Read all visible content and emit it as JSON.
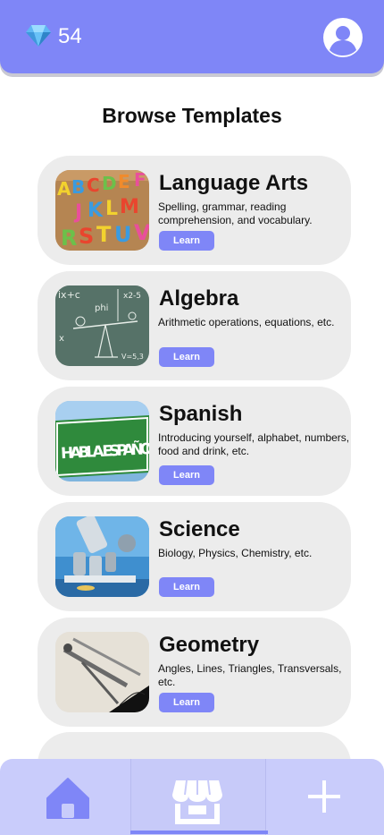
{
  "header": {
    "gem_icon": "diamond-icon",
    "gem_count": "54",
    "profile_icon": "user-avatar-icon"
  },
  "page_title": "Browse Templates",
  "templates": [
    {
      "title": "Language Arts",
      "description": "Spelling, grammar, reading comprehension, and vocabulary.",
      "learn_label": "Learn",
      "image": "alphabet-letters-image"
    },
    {
      "title": "Algebra",
      "description": "Arithmetic operations, equations, etc.",
      "learn_label": "Learn",
      "image": "chalkboard-equations-image"
    },
    {
      "title": "Spanish",
      "description": "Introducing yourself, alphabet, numbers, food and drink, etc.",
      "learn_label": "Learn",
      "image": "habla-espanol-sign-image",
      "image_text": "HABLA ESPAÑOL"
    },
    {
      "title": "Science",
      "description": "Biology, Physics, Chemistry, etc.",
      "learn_label": "Learn",
      "image": "microscope-image"
    },
    {
      "title": "Geometry",
      "description": "Angles, Lines, Triangles, Transversals, etc.",
      "learn_label": "Learn",
      "image": "compass-drawing-image"
    }
  ],
  "bottom_nav": {
    "items": [
      {
        "name": "home",
        "icon": "home-icon"
      },
      {
        "name": "store",
        "icon": "storefront-icon",
        "active": true
      },
      {
        "name": "create",
        "icon": "plus-icon"
      }
    ]
  },
  "colors": {
    "accent": "#7f86f7",
    "card_bg": "#ececec",
    "nav_bg": "#c9ccfb"
  }
}
